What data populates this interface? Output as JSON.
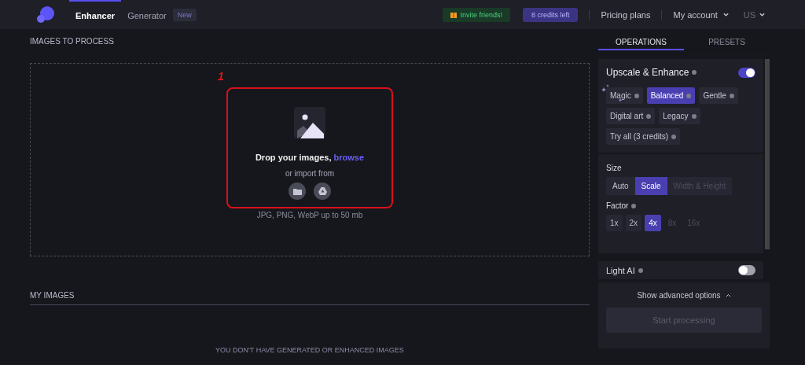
{
  "nav": {
    "tabs": [
      {
        "label": "Enhancer",
        "selected": true
      },
      {
        "label": "Generator",
        "selected": false
      }
    ],
    "new_badge": "New",
    "invite": "Invite friends!",
    "credits": "8 credits left",
    "pricing": "Pricing plans",
    "account": "My account",
    "language": "US"
  },
  "upload": {
    "title": "IMAGES TO PROCESS",
    "annotation": "1",
    "drop_text": "Drop your images, ",
    "browse": "browse",
    "import_text": "or import from",
    "formats": "JPG, PNG, WebP up to 50 mb"
  },
  "my_images": {
    "title": "MY IMAGES",
    "empty": "YOU DON'T HAVE GENERATED OR ENHANCED IMAGES"
  },
  "side_tabs": [
    {
      "label": "OPERATIONS",
      "selected": true
    },
    {
      "label": "PRESETS",
      "selected": false
    }
  ],
  "upscale": {
    "title": "Upscale & Enhance",
    "on": true,
    "modes": [
      {
        "label": "Magic",
        "selected": false
      },
      {
        "label": "Balanced",
        "selected": true
      },
      {
        "label": "Gentle",
        "selected": false
      },
      {
        "label": "Digital art",
        "selected": false
      },
      {
        "label": "Legacy",
        "selected": false
      },
      {
        "label": "Try all (3 credits)",
        "selected": false
      }
    ]
  },
  "size": {
    "title": "Size",
    "options": [
      {
        "label": "Auto",
        "selected": false,
        "disabled": false
      },
      {
        "label": "Scale",
        "selected": true,
        "disabled": false
      },
      {
        "label": "Width & Height",
        "selected": false,
        "disabled": true
      }
    ],
    "factor_title": "Factor",
    "factors": [
      {
        "label": "1x",
        "selected": false,
        "disabled": false
      },
      {
        "label": "2x",
        "selected": false,
        "disabled": false
      },
      {
        "label": "4x",
        "selected": true,
        "disabled": false
      },
      {
        "label": "8x",
        "selected": false,
        "disabled": true
      },
      {
        "label": "16x",
        "selected": false,
        "disabled": true
      }
    ]
  },
  "light_ai": {
    "title": "Light AI",
    "on": false
  },
  "advanced": "Show advanced options",
  "start": "Start processing"
}
